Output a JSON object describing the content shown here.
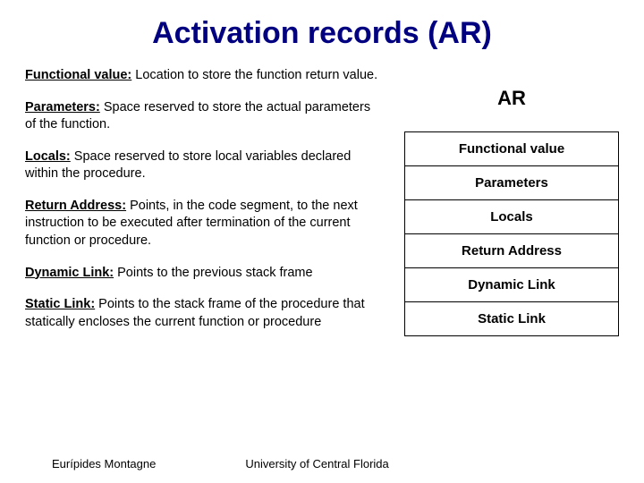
{
  "title": "Activation records (AR)",
  "definitions": [
    {
      "term": "Functional value:",
      "def": " Location to store the function return value."
    },
    {
      "term": "Parameters:",
      "def": " Space reserved  to store the actual parameters of the function."
    },
    {
      "term": "Locals:",
      "def": " Space reserved to store local variables declared  within the procedure."
    },
    {
      "term": "Return Address:",
      "def": " Points, in the code segment, to the next instruction to be executed after termination of the current function or procedure."
    },
    {
      "term": "Dynamic Link:",
      "def": " Points to the previous stack frame"
    },
    {
      "term": "Static Link:",
      "def": " Points to the stack frame  of the procedure that statically encloses the current function or procedure"
    }
  ],
  "diagram": {
    "heading": "AR",
    "cells": [
      "Functional value",
      "Parameters",
      "Locals",
      "Return Address",
      "Dynamic Link",
      "Static Link"
    ]
  },
  "footer": {
    "author": "Eurípides Montagne",
    "institution": "University of Central Florida"
  }
}
